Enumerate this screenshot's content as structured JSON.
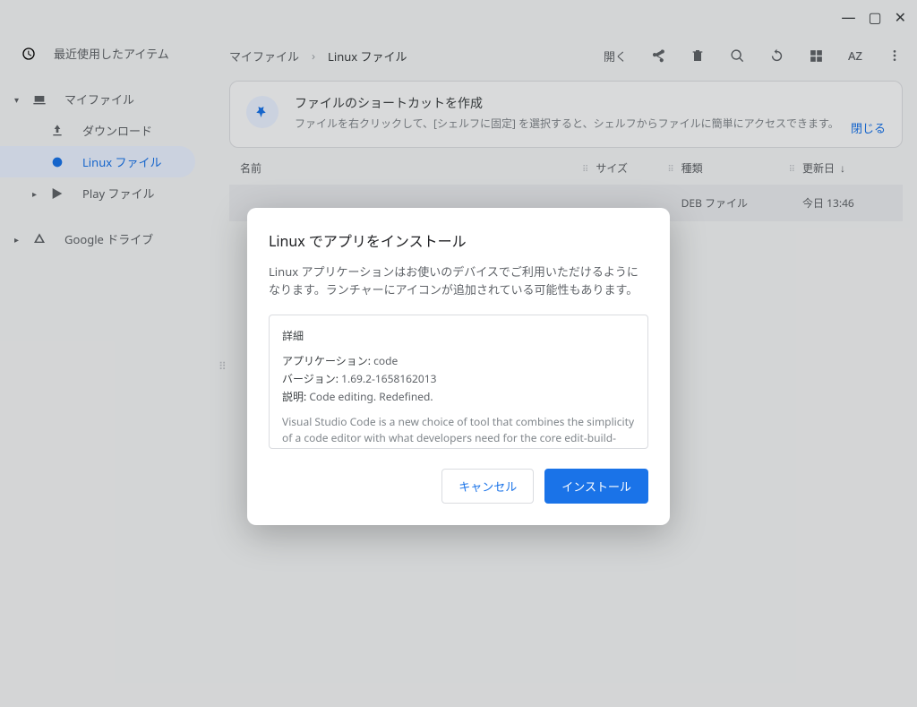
{
  "window": {
    "minimize": "—",
    "maximize": "▢",
    "close": "✕"
  },
  "sidebar": {
    "recent": "最近使用したアイテム",
    "items": [
      {
        "label": "マイファイル",
        "expanded": true,
        "level": 1
      },
      {
        "label": "ダウンロード",
        "level": 2
      },
      {
        "label": "Linux ファイル",
        "level": 2,
        "active": true
      },
      {
        "label": "Play ファイル",
        "level": 2,
        "hasChildren": true
      },
      {
        "label": "Google ドライブ",
        "level": 1,
        "hasChildren": true
      }
    ]
  },
  "toolbar": {
    "breadcrumb": {
      "root": "マイファイル",
      "sep": "›",
      "current": "Linux ファイル"
    },
    "open": "開く",
    "sort": "AZ"
  },
  "hint": {
    "title": "ファイルのショートカットを作成",
    "text": "ファイルを右クリックして、[シェルフに固定] を選択すると、シェルフからファイルに簡単にアクセスできます。",
    "close": "閉じる"
  },
  "columns": {
    "name": "名前",
    "size": "サイズ",
    "type": "種類",
    "date": "更新日"
  },
  "rows": [
    {
      "type": "DEB ファイル",
      "date": "今日 13:46"
    }
  ],
  "dialog": {
    "title": "Linux でアプリをインストール",
    "desc": "Linux アプリケーションはお使いのデバイスでご利用いただけるようになります。ランチャーにアイコンが追加されている可能性もあります。",
    "details_label": "詳細",
    "app": {
      "k": "アプリケーション:",
      "v": "code"
    },
    "version": {
      "k": "バージョン:",
      "v": "1.69.2-1658162013"
    },
    "desc_kv": {
      "k": "説明:",
      "v": "Code editing. Redefined."
    },
    "long": "Visual Studio Code is a new choice of tool that combines the simplicity of a code editor with what developers need for the core edit-build-debug cycle. See https://code.visualstudio.com/docs/setup/linux for installation instructions and FAQ.",
    "cancel": "キャンセル",
    "install": "インストール"
  }
}
